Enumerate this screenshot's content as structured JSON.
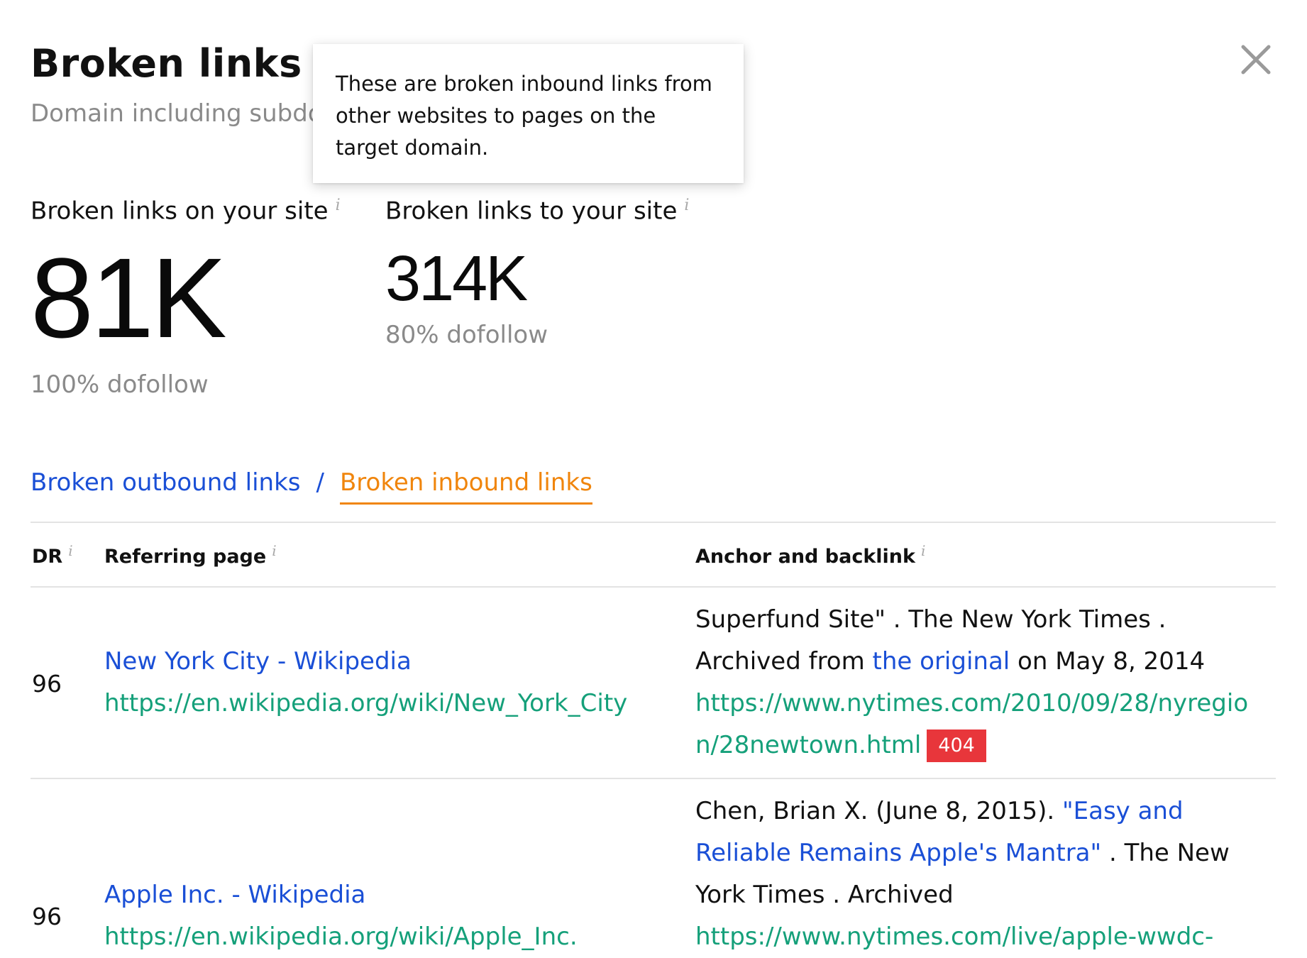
{
  "header": {
    "title": "Broken links fo",
    "subtitle": "Domain including subdo"
  },
  "close": {
    "icon": "close-icon"
  },
  "tooltip": {
    "text": "These are broken inbound links from other websites to pages on the target domain."
  },
  "stats": [
    {
      "label": "Broken links on your site",
      "value": "81K",
      "sub": "100% dofollow"
    },
    {
      "label": "Broken links to your site",
      "value": "314K",
      "sub": "80% dofollow"
    }
  ],
  "info_glyph": "i",
  "tabs": {
    "outbound": "Broken outbound links",
    "separator": "/",
    "inbound": "Broken inbound links"
  },
  "table": {
    "headers": [
      "DR",
      "Referring page",
      "Anchor and backlink"
    ],
    "rows": [
      {
        "dr": "96",
        "page_title": "New York City - Wikipedia",
        "page_url": "https://en.wikipedia.org/wiki/New_York_City",
        "anchor_pre": "Superfund Site\" . The New York Times . Archived from ",
        "anchor_link": "the original",
        "anchor_post": " on May 8, 2014",
        "backlink": "https://www.nytimes.com/2010/09/28/nyregion/28newtown.html",
        "status": "404"
      },
      {
        "dr": "96",
        "page_title": "Apple Inc. - Wikipedia",
        "page_url": "https://en.wikipedia.org/wiki/Apple_Inc.",
        "anchor_pre": "Chen, Brian X. (June 8, 2015). ",
        "anchor_link": "\"Easy and Reliable Remains Apple's Mantra\"",
        "anchor_post": " . The New York Times . Archived",
        "backlink": "https://www.nytimes.com/live/apple-wwdc-"
      }
    ]
  },
  "colors": {
    "link_blue": "#1a4fd6",
    "link_green": "#15a07a",
    "active_tab": "#f0850c",
    "error_badge": "#e8363b",
    "muted_text": "#8a8a8a"
  }
}
